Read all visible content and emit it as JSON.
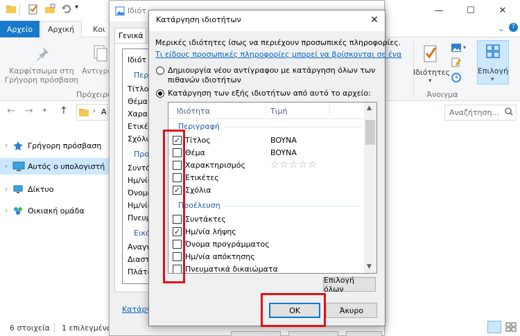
{
  "explorer": {
    "tabs": {
      "file": "Αρχείο",
      "home": "Αρχική",
      "share": "Κοι"
    },
    "ribbon": {
      "pin_label_1": "Καρφίτσωμα στη",
      "pin_label_2": "Γρήγορη πρόσβαση",
      "copy_label": "Αντιγρα",
      "group_clipboard": "Πρόχειρο",
      "properties_label": "Ιδιότητες",
      "group_open": "Άνοιγμα",
      "select_label": "Επιλογή"
    },
    "nav_letter": "Α",
    "search_placeholder": "Αναζήτηση...",
    "nav": [
      {
        "label": "Γρήγορη πρόσβαση"
      },
      {
        "label": "Αυτός ο υπολογιστή"
      },
      {
        "label": "Δίκτυο"
      },
      {
        "label": "Οικιακή ομάδα"
      }
    ],
    "status": {
      "count": "6 στοιχεία",
      "selected": "1 επιλεγμένο"
    }
  },
  "props_dialog": {
    "title": "Ιδιότ",
    "tab_general": "Γενικά",
    "rows": [
      "Ιδιότ",
      "Περι",
      "Τίτλος",
      "Θέμα",
      "Χαρακ",
      "Ετικέτ",
      "Σχόλι",
      "Προ",
      "Συντά",
      "Ημ/νία",
      "Όνομα",
      "Ημ/νία",
      "Πνευμ",
      "Εικό",
      "Αναγν",
      "Διαστ",
      "Πλάτο"
    ],
    "remove_link": "Κατάργη"
  },
  "dialog": {
    "title": "Κατάργηση ιδιοτήτων",
    "close": "✕",
    "intro": "Μερικές ιδιότητες ίσως να περιέχουν προσωπικές πληροφορίες.",
    "link": "Τι είδους προσωπικές πληροφορίες μπορεί να βρίσκονται σε ένα",
    "radio_copy_1": "Δημιουργία νέου αντίγραφου με κατάργηση όλων των",
    "radio_copy_2": "πιθανών ιδιοτήτων",
    "radio_remove": "Κατάργηση των εξής ιδιοτήτων από αυτό το αρχείο:",
    "col_property": "Ιδιότητα",
    "col_value": "Τιμή",
    "group_description": "Περιγραφή",
    "group_origin": "Προέλευση",
    "description_rows": [
      {
        "name": "Τίτλος",
        "value": "BOYNA",
        "checked": true
      },
      {
        "name": "Θέμα",
        "value": "BOYNA",
        "checked": false
      },
      {
        "name": "Χαρακτηρισμός",
        "value": "",
        "checked": false,
        "rating_stars": "☆☆☆☆☆"
      },
      {
        "name": "Ετικέτες",
        "value": "",
        "checked": false
      },
      {
        "name": "Σχόλια",
        "value": "",
        "checked": true
      }
    ],
    "origin_rows": [
      {
        "name": "Συντάκτες",
        "checked": false
      },
      {
        "name": "Ημ/νία λήψης",
        "checked": true
      },
      {
        "name": "Όνομα προγράμματος",
        "checked": false
      },
      {
        "name": "Ημ/νία απόκτησης",
        "checked": false
      },
      {
        "name": "Πνευματικά δικαιώματα",
        "checked": false
      }
    ],
    "select_all": "Επιλογή όλων",
    "ok": "OK",
    "cancel": "Άκυρο",
    "check_glyph": "✓"
  },
  "colors": {
    "highlight": "#e0101a",
    "accent": "#0078d7",
    "file_tab": "#1979ca"
  }
}
